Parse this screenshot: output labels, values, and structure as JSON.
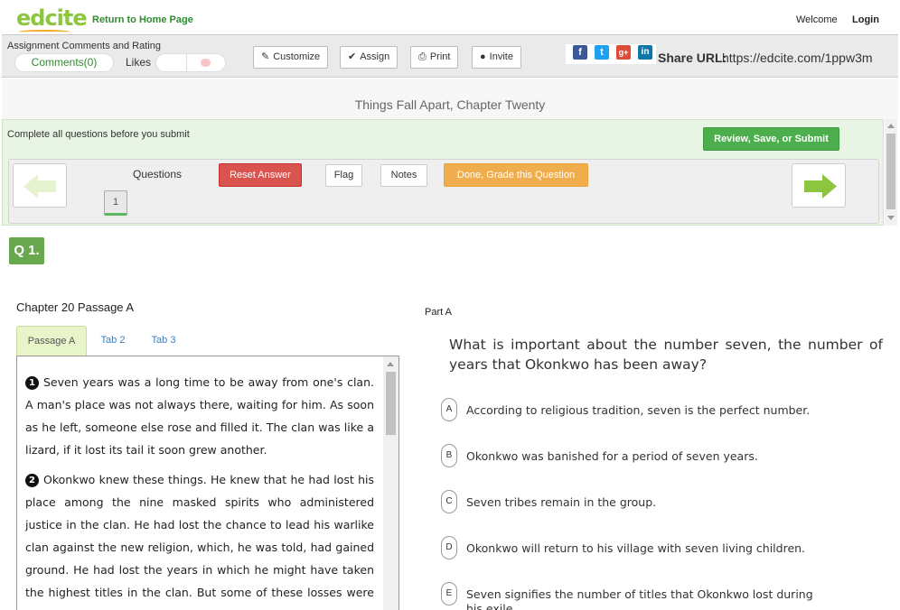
{
  "header": {
    "logo": "edcite",
    "home_link": "Return to Home Page",
    "welcome": "Welcome",
    "login": "Login"
  },
  "toolbar": {
    "comments_title": "Assignment Comments and Rating",
    "comments_label": "Comments(0)",
    "likes_label": "Likes",
    "buttons": {
      "customize": "Customize",
      "assign": "Assign",
      "print": "Print",
      "invite": "Invite"
    },
    "social_icons": [
      "facebook-icon",
      "twitter-icon",
      "google-plus-icon",
      "linkedin-icon"
    ],
    "share_label": "Share URL:",
    "share_url": "https://edcite.com/1ppw3m"
  },
  "page_title": "Things Fall Apart, Chapter Twenty",
  "question_panel": {
    "note": "Complete all questions before you submit",
    "submit_label": "Review, Save, or Submit",
    "questions_label": "Questions",
    "question_numbers": [
      "1"
    ],
    "reset_label": "Reset Answer",
    "flag_label": "Flag",
    "notes_label": "Notes",
    "done_label": "Done, Grade this Question"
  },
  "question_badge": "Q 1.",
  "passage": {
    "heading": "Chapter 20 Passage A",
    "tabs": [
      "Passage A",
      "Tab 2",
      "Tab 3"
    ],
    "paragraphs": [
      {
        "num": "1",
        "text": "Seven years was a long time to be away from one's clan. A man's place was not always there, waiting for him. As soon as he left, someone else rose and filled it. The clan was like a lizard, if it lost its tail it soon grew another."
      },
      {
        "num": "2",
        "text": "Okonkwo knew these things. He knew that he had lost his place among the nine masked spirits who administered justice in the clan. He had lost the chance to lead his warlike clan against the new religion, which, he was told, had gained ground. He had lost the years in which he might have taken the highest titles in the clan. But some of these losses were not irreparable. He was"
      }
    ]
  },
  "question": {
    "part_label": "Part A",
    "prompt": "What is important about the number seven, the number of years that Okonkwo has been away?",
    "options": [
      {
        "letter": "A",
        "text": "According to religious tradition, seven is the perfect number."
      },
      {
        "letter": "B",
        "text": "Okonkwo was banished for a period of seven years."
      },
      {
        "letter": "C",
        "text": "Seven tribes remain in the group."
      },
      {
        "letter": "D",
        "text": "Okonkwo will return to his village with seven living children."
      },
      {
        "letter": "E",
        "text": "Seven signifies the number of titles that Okonkwo lost during his exile."
      }
    ]
  },
  "colors": {
    "brand_green": "#8cc63f",
    "panel_green": "#e8f4e4",
    "submit_green": "#4cae4c",
    "reset_red": "#d9534f",
    "done_orange": "#f0ad4e",
    "badge_green": "#6aa84f"
  }
}
